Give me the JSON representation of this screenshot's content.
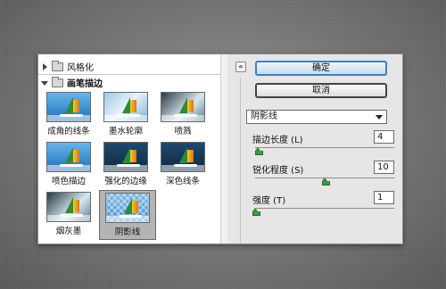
{
  "tree": {
    "collapsed_group": "风格化",
    "expanded_group": "画笔描边"
  },
  "filters": [
    {
      "label": "成角的线条",
      "style": "normal"
    },
    {
      "label": "墨水轮廓",
      "style": "sketch"
    },
    {
      "label": "喷溅",
      "style": "bw"
    },
    {
      "label": "喷色描边",
      "style": "normal"
    },
    {
      "label": "强化的边缘",
      "style": "dark"
    },
    {
      "label": "深色线条",
      "style": "dark"
    },
    {
      "label": "烟灰墨",
      "style": "bw"
    },
    {
      "label": "阴影线",
      "style": "hatch"
    }
  ],
  "selected_filter": "阴影线",
  "buttons": {
    "ok": "确定",
    "cancel": "取消",
    "collapse": "«"
  },
  "dropdown": {
    "selected": "阴影线"
  },
  "params": [
    {
      "label": "描边长度 (L)",
      "value": "4",
      "slider_fraction": 0.04
    },
    {
      "label": "锐化程度 (S)",
      "value": "10",
      "slider_fraction": 0.5
    },
    {
      "label": "强度 (T)",
      "value": "1",
      "slider_fraction": 0.0
    }
  ],
  "colors": {
    "default_button_border": "#3d7fc0",
    "slider_knob": "#3a9a48"
  }
}
